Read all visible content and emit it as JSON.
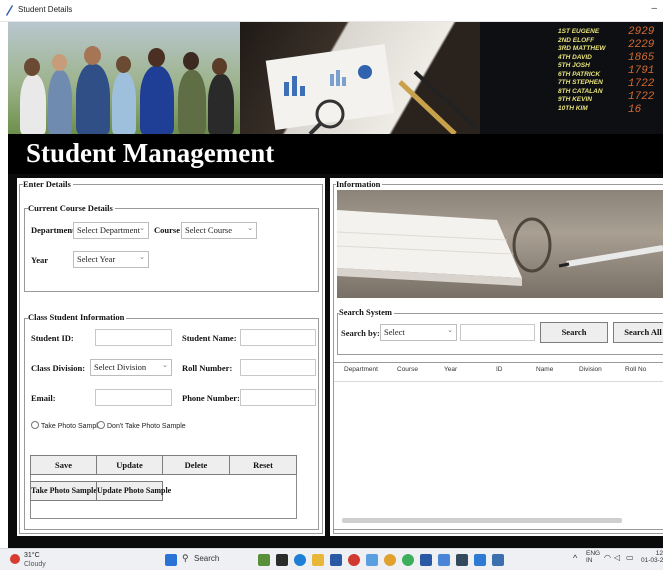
{
  "window": {
    "title": "Student Details",
    "minimize_glyph": "–"
  },
  "banner": {
    "names": [
      "1ST EUGENE",
      "2ND ELOFF",
      "3RD MATTHEW",
      "4TH DAVID",
      "5TH JOSH",
      "6TH PATRICK",
      "7TH STEPHEN",
      "8TH CATALAN",
      "9TH KEVIN",
      "10TH KIM"
    ],
    "numbers": [
      "2929",
      "2229",
      "1865",
      "1791",
      "1722",
      "1722",
      "16"
    ]
  },
  "header": {
    "title": "Student Management"
  },
  "enter_details": {
    "legend": "Enter Details",
    "current_course": {
      "legend": "Current Course Details",
      "department_label": "Department",
      "department_value": "Select Department",
      "course_label": "Course",
      "course_value": "Select Course",
      "year_label": "Year",
      "year_value": "Select Year"
    },
    "class_info": {
      "legend": "Class Student Information",
      "student_id_label": "Student ID:",
      "student_name_label": "Student Name:",
      "class_division_label": "Class Division:",
      "class_division_value": "Select Division",
      "roll_number_label": "Roll Number:",
      "email_label": "Email:",
      "phone_number_label": "Phone Number:",
      "radio_take": "Take Photo Sample",
      "radio_dont": "Don't Take Photo Sample"
    },
    "buttons": {
      "save": "Save",
      "update": "Update",
      "delete": "Delete",
      "reset": "Reset",
      "take_photo": "Take Photo Sample",
      "update_photo": "Update Photo Sample"
    }
  },
  "information": {
    "legend": "Information",
    "search": {
      "legend": "Search System",
      "search_by_label": "Search by:",
      "search_by_value": "Select",
      "search_button": "Search",
      "search_all_button": "Search All"
    },
    "table_columns": [
      "Department",
      "Course",
      "Year",
      "ID",
      "Name",
      "Division",
      "Roll No"
    ]
  },
  "taskbar": {
    "weather_temp": "31°C",
    "weather_desc": "Cloudy",
    "search_placeholder": "Search",
    "lang_top": "ENG",
    "lang_bottom": "IN",
    "clock_top": "12",
    "clock_bottom": "01-03-2"
  },
  "colors": {
    "title_strip": "#000000",
    "frame_bg": "#ffffff",
    "button_bg": "#eeeeee",
    "taskbar_bg": "#eef0f4"
  }
}
